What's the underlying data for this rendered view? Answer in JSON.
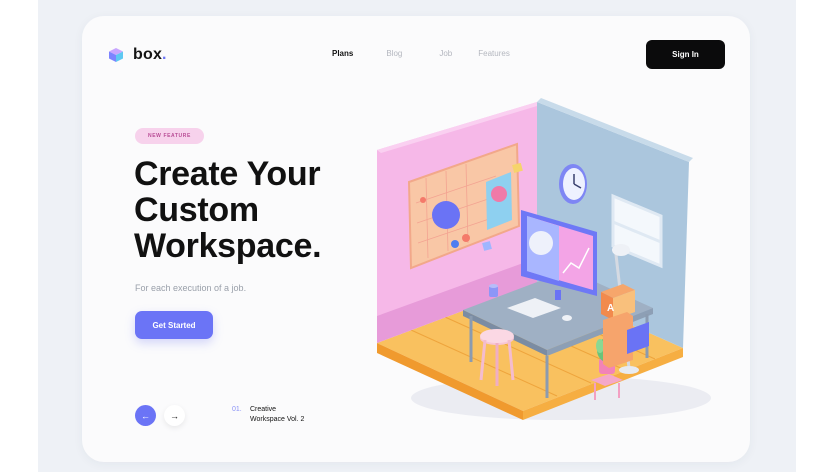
{
  "header": {
    "logo_text": "box",
    "logo_dot": ".",
    "nav": [
      {
        "label": "Plans",
        "active": true
      },
      {
        "label": "Blog",
        "active": false
      },
      {
        "label": "Job",
        "active": false
      },
      {
        "label": "Features",
        "active": false
      }
    ],
    "signin_label": "Sign In"
  },
  "hero": {
    "badge": "NEW FEATURE",
    "headline_lines": [
      "Create Your",
      "Custom",
      "Workspace."
    ],
    "subtext": "For each execution of a job.",
    "cta_label": "Get Started"
  },
  "pager": {
    "prev_icon": "←",
    "next_icon": "→",
    "slide_number": "01.",
    "slide_title_lines": [
      "Creative",
      "Workspace Vol. 2"
    ]
  },
  "colors": {
    "accent": "#6b74f6",
    "badge_bg": "#f7d2ec",
    "dark_button": "#0b0b0c",
    "room_pink": "#f6b6e6",
    "room_blue": "#a9c4dc",
    "floor": "#f7b64c"
  },
  "icons": {
    "logo": "cube-logo-icon",
    "prev": "arrow-left-icon",
    "next": "arrow-right-icon"
  }
}
